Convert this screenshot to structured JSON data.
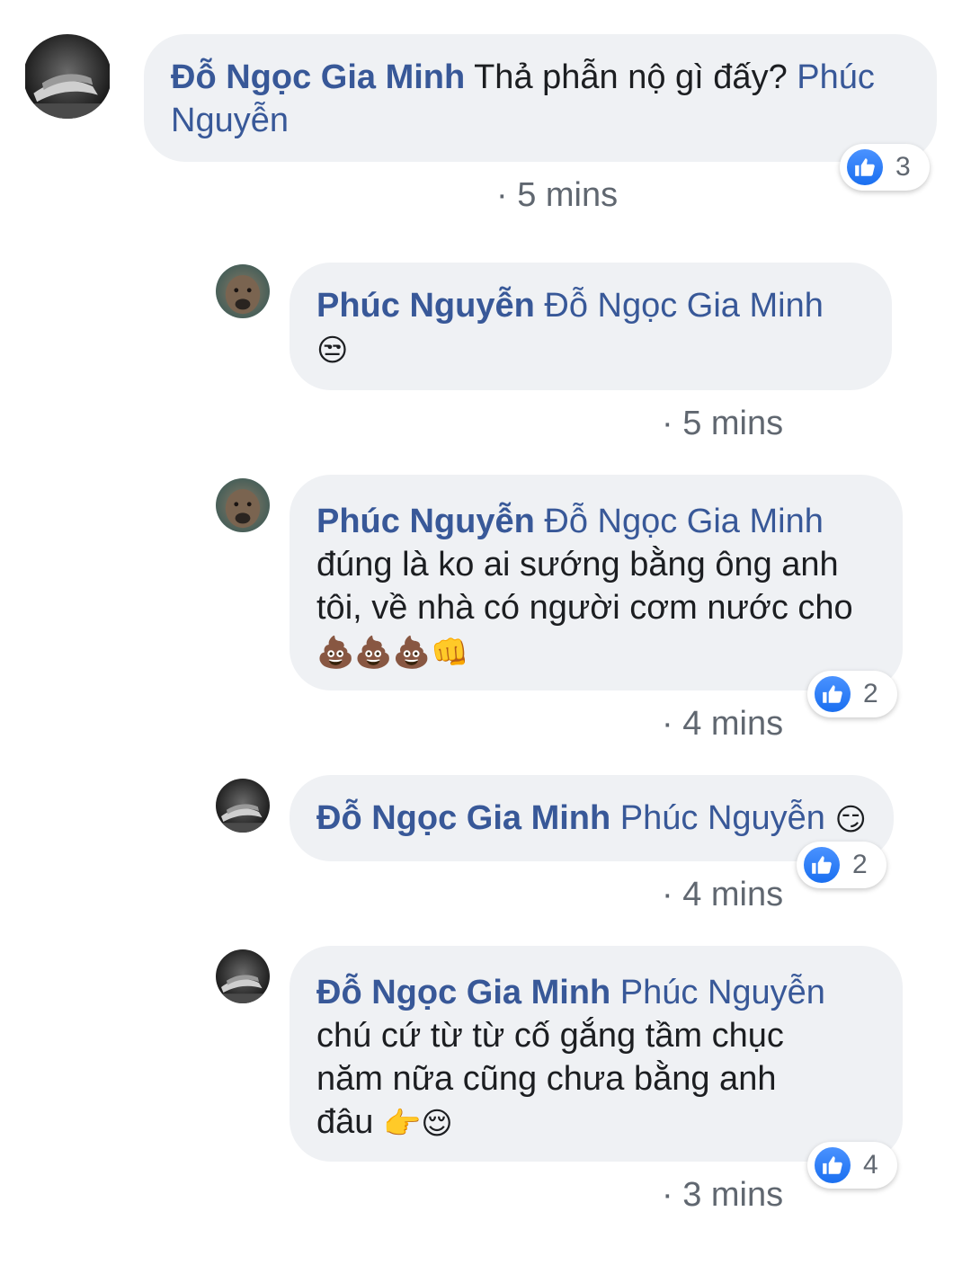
{
  "comments": [
    {
      "author": "Đỗ Ngọc Gia Minh",
      "text": "Thả phẫn nộ gì đấy?",
      "tag": "Phúc Nguyễn",
      "time": "· 5 mins",
      "likes": "3"
    },
    {
      "author": "Phúc Nguyễn",
      "tag": "Đỗ Ngọc Gia Minh",
      "emoji": "😒",
      "time": "· 5 mins"
    },
    {
      "author": "Phúc Nguyễn",
      "tag": "Đỗ Ngọc Gia Minh",
      "text": "đúng là ko ai sướng bằng ông anh tôi, về nhà có người cơm nước cho",
      "emoji": "💩💩💩👊",
      "time": "· 4 mins",
      "likes": "2"
    },
    {
      "author": "Đỗ Ngọc Gia Minh",
      "tag": "Phúc Nguyễn",
      "emoji": "😏",
      "time": "· 4 mins",
      "likes": "2"
    },
    {
      "author": "Đỗ Ngọc Gia Minh",
      "tag": "Phúc Nguyễn",
      "text": "chú cứ từ từ cố gắng tầm chục năm nữa cũng chưa bằng anh đâu",
      "emoji": "👉😌",
      "time": "· 3 mins",
      "likes": "4"
    }
  ],
  "icons": {
    "like": "like-thumbs-up-icon",
    "avatar_dark": "hands-photo-avatar",
    "avatar_dog": "dog-photo-avatar"
  },
  "colors": {
    "name_blue": "#385898",
    "bubble_bg": "#eff1f4",
    "like_blue": "#1a6ff0",
    "meta_gray": "#606770"
  }
}
